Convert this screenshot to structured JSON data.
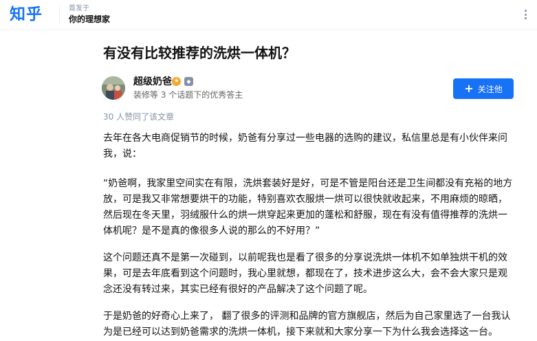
{
  "header": {
    "logo_text": "知乎",
    "publish_label": "首发于",
    "column_name": "你的理想家"
  },
  "article": {
    "title": "有没有比较推荐的洗烘一体机？",
    "author": {
      "name": "超级奶爸",
      "description": "装修等 3 个话题下的优秀答主",
      "follow_label": "关注他"
    },
    "likes_text": "30 人赞同了该文章",
    "paragraphs": [
      "去年在各大电商促销节的时候，奶爸有分享过一些电器的选购的建议，私信里总是有小伙伴来问我，说：",
      "“奶爸啊，我家里空间实在有限，洗烘套装好是好，可是不管是阳台还是卫生间都没有充裕的地方放，可是我又非常想要烘干的功能，特别喜欢衣服烘一烘可以很快就收起来，不用麻烦的晾晒，然后现在冬天里，羽绒服什么的烘一烘穿起来更加的蓬松和舒服，现在有没有值得推荐的洗烘一体机呢？是不是真的像很多人说的那么的不好用？”",
      "这个问题还真不是第一次碰到，以前呢我也是看了很多的分享说洗烘一体机不如单独烘干机的效果，可是去年底看到这个问题时，我心里就想，都现在了，技术进步这么大，会不会大家只是观念还没有转过来，其实已经有很好的产品解决了这个问题了呢。",
      "于是奶爸的好奇心上来了， 翻了很多的评测和品牌的官方旗舰店，然后为自己家里选了一台我认为是已经可以达到奶爸需求的洗烘一体机，接下来就和大家分享一下为什么我会选择这一台。"
    ]
  },
  "colors": {
    "brand": "#1772f6",
    "muted": "#8590a6",
    "badge_gold": "#f6a623"
  },
  "icons": {
    "more": "more-vertical-icon",
    "follow": "plus-icon",
    "badge1": "gold-badge-icon",
    "badge2": "member-badge-icon"
  }
}
